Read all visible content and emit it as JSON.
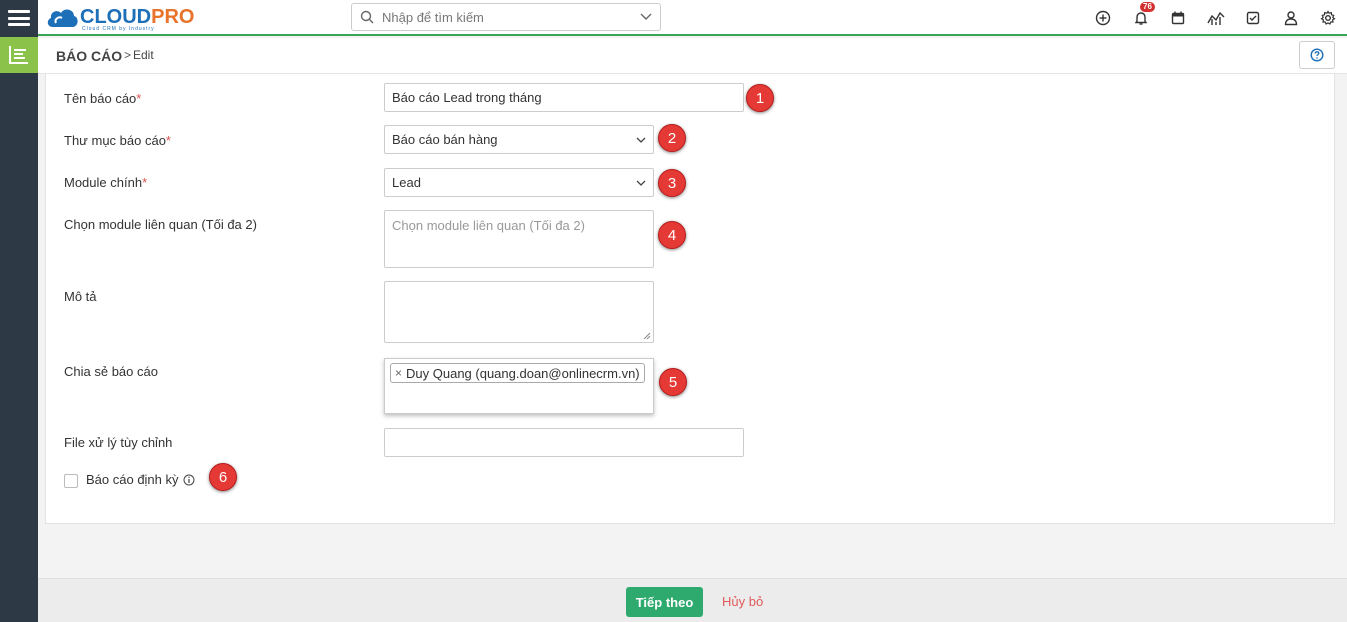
{
  "app": {
    "logo_part1": "CLOUD",
    "logo_part2": "PRO",
    "logo_tagline": "Cloud CRM by Industry"
  },
  "search": {
    "placeholder": "Nhập để tìm kiếm"
  },
  "toolbar": {
    "icons": [
      "plus-circle-icon",
      "bell-icon",
      "calendar-icon",
      "chart-icon",
      "checkbox-icon",
      "user-icon",
      "gear-icon"
    ],
    "notification_count": "76"
  },
  "breadcrumb": {
    "module": "BÁO CÁO",
    "separator": ">",
    "current": "Edit"
  },
  "form": {
    "report_name": {
      "label": "Tên báo cáo",
      "required": "*",
      "value": "Báo cáo Lead trong tháng"
    },
    "report_folder": {
      "label": "Thư mục báo cáo",
      "required": "*",
      "value": "Báo cáo bán hàng"
    },
    "main_module": {
      "label": "Module chính",
      "required": "*",
      "value": "Lead"
    },
    "related_modules": {
      "label": "Chọn module liên quan (Tối đa 2)",
      "placeholder": "Chọn module liên quan (Tối đa 2)"
    },
    "description": {
      "label": "Mô tả",
      "value": ""
    },
    "share": {
      "label": "Chia sẻ báo cáo",
      "tags": [
        "Duy Quang (quang.doan@onlinecrm.vn)"
      ]
    },
    "custom_file": {
      "label": "File xử lý tùy chỉnh",
      "value": ""
    },
    "scheduled": {
      "label": "Báo cáo định kỳ",
      "checked": false
    }
  },
  "markers": [
    "1",
    "2",
    "3",
    "4",
    "5",
    "6"
  ],
  "footer": {
    "next_label": "Tiếp theo",
    "cancel_label": "Hủy bỏ"
  },
  "colors": {
    "accent_green": "#2eaa6e",
    "rail": "#2d3a45",
    "rail_active": "#8bc34a",
    "marker": "#e53935",
    "cancel": "#e05a5a"
  }
}
